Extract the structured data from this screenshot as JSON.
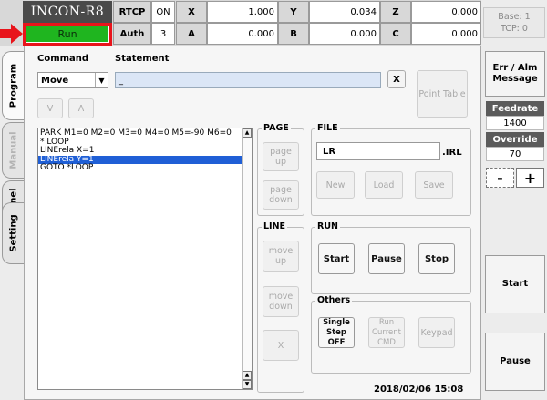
{
  "header": {
    "title": "INCON-R8",
    "run_label": "Run",
    "rtcp_label": "RTCP",
    "rtcp_value": "ON",
    "auth_label": "Auth",
    "auth_value": "3",
    "coords": [
      {
        "axis": "X",
        "value": "1.000"
      },
      {
        "axis": "Y",
        "value": "0.034"
      },
      {
        "axis": "Z",
        "value": "0.000"
      },
      {
        "axis": "A",
        "value": "0.000"
      },
      {
        "axis": "B",
        "value": "0.000"
      },
      {
        "axis": "C",
        "value": "0.000"
      }
    ],
    "base_line": "Base: 1",
    "tcp_line": "TCP: 0"
  },
  "tabs": [
    "Program",
    "Manual",
    "Panel",
    "Setting"
  ],
  "editor": {
    "command_label": "Command",
    "statement_label": "Statement",
    "command_value": "Move",
    "statement_value": "_",
    "clear_label": "X",
    "point_table_label": "Point Table",
    "down_label": "V",
    "up_label": "Λ"
  },
  "program_lines": [
    {
      "text": "PARK M1=0 M2=0 M3=0 M4=0 M5=-90 M6=0",
      "selected": false
    },
    {
      "text": "* LOOP",
      "selected": false
    },
    {
      "text": "LINErela X=1",
      "selected": false
    },
    {
      "text": "LINErela Y=1",
      "selected": true
    },
    {
      "text": "GOTO *LOOP",
      "selected": false
    }
  ],
  "page_group": {
    "title": "PAGE",
    "page_up": "page up",
    "page_down": "page down"
  },
  "line_group": {
    "title": "LINE",
    "move_up": "move up",
    "move_down": "move down",
    "delete": "X"
  },
  "file_group": {
    "title": "FILE",
    "filename": "LR",
    "ext": ".IRL",
    "new": "New",
    "load": "Load",
    "save": "Save"
  },
  "run_group": {
    "title": "RUN",
    "start": "Start",
    "pause": "Pause",
    "stop": "Stop"
  },
  "others_group": {
    "title": "Others",
    "single_step": "Single Step OFF",
    "run_current": "Run Current CMD",
    "keypad": "Keypad"
  },
  "datetime": "2018/02/06 15:08",
  "right": {
    "err_alm": "Err / Alm Message",
    "feedrate_label": "Feedrate",
    "feedrate_value": "1400",
    "override_label": "Override",
    "override_value": "70",
    "minus": "-",
    "plus": "+",
    "start": "Start",
    "pause": "Pause"
  },
  "colors": {
    "run_green": "#1fb51f",
    "highlight_red": "#e8141b",
    "selection_blue": "#1f5fd6",
    "title_dark": "#4a4a4a"
  }
}
